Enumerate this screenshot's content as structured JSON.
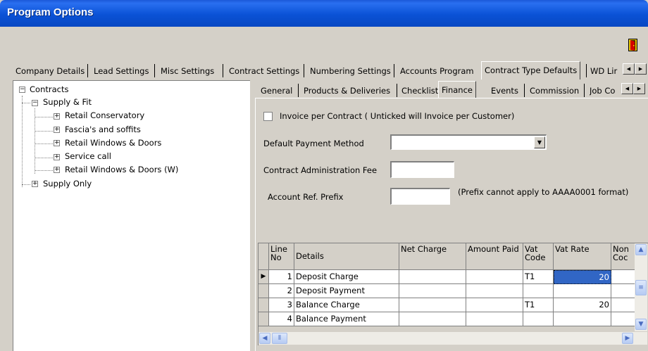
{
  "window": {
    "title": "Program Options"
  },
  "toolbar": {
    "exit_icon": "exit-door-icon"
  },
  "main_tabs": [
    {
      "label": "Company Details"
    },
    {
      "label": "Lead Settings"
    },
    {
      "label": "Misc Settings"
    },
    {
      "label": "Contract Settings"
    },
    {
      "label": "Numbering Settings"
    },
    {
      "label": "Accounts Program"
    },
    {
      "label": "Contract Type Defaults",
      "active": true
    },
    {
      "label": "WD Lir"
    }
  ],
  "tree": {
    "root": {
      "label": "Contracts",
      "expander": "⊟"
    },
    "supply_fit": {
      "label": "Supply & Fit",
      "expander": "⊟"
    },
    "children": [
      {
        "label": "Retail Conservatory",
        "expander": "⊞"
      },
      {
        "label": "Fascia's and soffits",
        "expander": "⊞"
      },
      {
        "label": "Retail Windows & Doors",
        "expander": "⊞"
      },
      {
        "label": "Service call",
        "expander": "⊞"
      },
      {
        "label": "Retail Windows & Doors (W)",
        "expander": "⊞"
      }
    ],
    "supply_only": {
      "label": "Supply Only",
      "expander": "⊞"
    }
  },
  "sub_tabs": [
    {
      "label": "General"
    },
    {
      "label": "Products & Deliveries"
    },
    {
      "label": "Checklist"
    },
    {
      "label": "Finance",
      "active": true
    },
    {
      "label": "Events"
    },
    {
      "label": "Commission"
    },
    {
      "label": "Job Co"
    }
  ],
  "finance": {
    "invoice_per_contract_label": "Invoice per Contract ( Unticked will Invoice per Customer)",
    "invoice_per_contract_checked": false,
    "default_payment_method_label": "Default Payment Method",
    "default_payment_method_value": "",
    "admin_fee_label": "Contract Administration Fee",
    "admin_fee_value": "",
    "account_prefix_label": "Account Ref. Prefix",
    "account_prefix_value": "",
    "account_prefix_note": "(Prefix cannot apply to AAAA0001 format)"
  },
  "grid": {
    "columns": [
      "Line No",
      "Details",
      "Net Charge",
      "Amount Paid",
      "Vat Code",
      "Vat Rate",
      "Non Coc"
    ],
    "rows": [
      {
        "line": "1",
        "details": "Deposit Charge",
        "net": "",
        "paid": "",
        "vat_code": "T1",
        "vat_rate": "20",
        "non": "",
        "current": true
      },
      {
        "line": "2",
        "details": "Deposit Payment",
        "net": "",
        "paid": "",
        "vat_code": "",
        "vat_rate": "",
        "non": ""
      },
      {
        "line": "3",
        "details": "Balance Charge",
        "net": "",
        "paid": "",
        "vat_code": "T1",
        "vat_rate": "20",
        "non": ""
      },
      {
        "line": "4",
        "details": "Balance Payment",
        "net": "",
        "paid": "",
        "vat_code": "",
        "vat_rate": "",
        "non": ""
      }
    ],
    "current_row_indicator": "▶"
  },
  "colors": {
    "title_bar": "#0a52d6",
    "selection": "#3166c5",
    "face": "#d4d0c8"
  }
}
